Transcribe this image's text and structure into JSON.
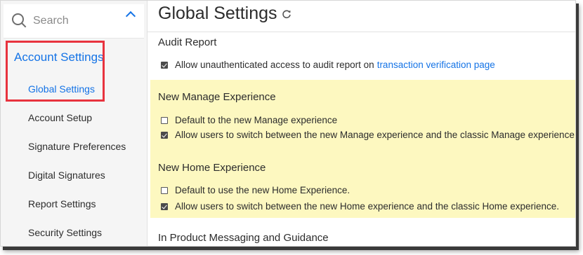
{
  "sidebar": {
    "search_placeholder": "Search",
    "section": "Account Settings",
    "items": [
      {
        "label": "Global Settings"
      },
      {
        "label": "Account Setup"
      },
      {
        "label": "Signature Preferences"
      },
      {
        "label": "Digital Signatures"
      },
      {
        "label": "Report Settings"
      },
      {
        "label": "Security Settings"
      }
    ]
  },
  "main": {
    "title": "Global Settings",
    "audit": {
      "title": "Audit Report",
      "option": {
        "checked": true,
        "text": "Allow unauthenticated access to audit report on",
        "link": "transaction verification page"
      }
    },
    "manage": {
      "title": "New Manage Experience",
      "options": [
        {
          "checked": false,
          "text": "Default to the new Manage experience"
        },
        {
          "checked": true,
          "text": "Allow users to switch between the new Manage experience and the classic Manage experience"
        }
      ]
    },
    "home": {
      "title": "New Home Experience",
      "options": [
        {
          "checked": false,
          "text": "Default to use the new Home Experience."
        },
        {
          "checked": true,
          "text": "Allow users to switch between the new Home experience and the classic Home experience."
        }
      ]
    },
    "messaging": {
      "title": "In Product Messaging and Guidance"
    }
  },
  "colors": {
    "accent": "#1473e6",
    "highlight_border": "#e8333e",
    "highlight_fill": "#fdf8c0"
  }
}
